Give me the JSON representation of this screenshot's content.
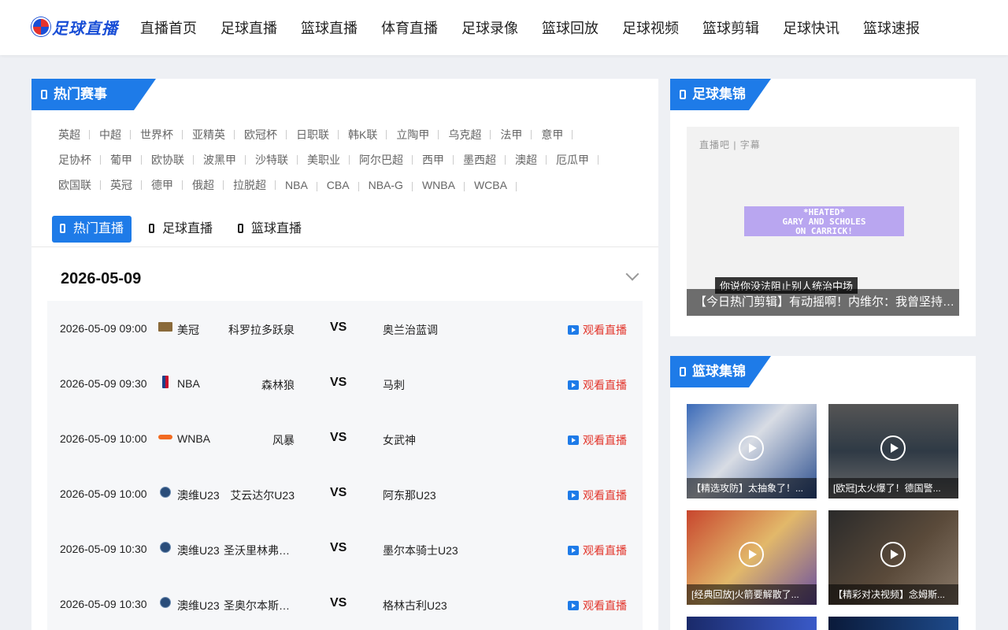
{
  "header": {
    "logo_text": "足球直播",
    "nav": [
      "直播首页",
      "足球直播",
      "篮球直播",
      "体育直播",
      "足球录像",
      "篮球回放",
      "足球视频",
      "篮球剪辑",
      "足球快讯",
      "篮球速报"
    ]
  },
  "hot_events": {
    "title": "热门赛事",
    "rows": [
      [
        "英超",
        "中超",
        "世界杯",
        "亚精英",
        "欧冠杯",
        "日职联",
        "韩K联",
        "立陶甲",
        "乌克超",
        "法甲",
        "意甲"
      ],
      [
        "足协杯",
        "葡甲",
        "欧协联",
        "波黑甲",
        "沙特联",
        "美职业",
        "阿尔巴超",
        "西甲",
        "墨西超",
        "澳超",
        "厄瓜甲"
      ],
      [
        "欧国联",
        "英冠",
        "德甲",
        "俄超",
        "拉脱超",
        "NBA",
        "CBA",
        "NBA-G",
        "WNBA",
        "WCBA"
      ]
    ]
  },
  "tabs": [
    "热门直播",
    "足球直播",
    "篮球直播"
  ],
  "date": "2026-05-09",
  "vs_label": "VS",
  "watch_label": "观看直播",
  "matches": [
    {
      "time": "2026-05-09 09:00",
      "league": "美冠",
      "home": "科罗拉多跃泉",
      "away": "奥兰治蓝调",
      "icon": "league-flag-icon"
    },
    {
      "time": "2026-05-09 09:30",
      "league": "NBA",
      "home": "森林狼",
      "away": "马刺",
      "icon": "nba-logo-icon"
    },
    {
      "time": "2026-05-09 10:00",
      "league": "WNBA",
      "home": "风暴",
      "away": "女武神",
      "icon": "wnba-logo-icon"
    },
    {
      "time": "2026-05-09 10:00",
      "league": "澳维U23",
      "home": "艾云达尔U23",
      "away": "阿东那U23",
      "icon": "globe-icon"
    },
    {
      "time": "2026-05-09 10:30",
      "league": "澳维U23",
      "home": "圣沃里林弗洛U...",
      "away": "墨尔本骑士U23",
      "icon": "globe-icon"
    },
    {
      "time": "2026-05-09 10:30",
      "league": "澳维U23",
      "home": "圣奥尔本斯圣...",
      "away": "格林古利U23",
      "icon": "globe-icon"
    }
  ],
  "football_highlights": {
    "title": "足球集锦",
    "watermark": "直播吧 | 字幕",
    "slate": [
      "*HEATED*",
      "GARY AND SCHOLES",
      "ON CARRICK!"
    ],
    "subtitle": "你说你没法阻止别人统治中场",
    "caption": "【今日热门剪辑】有动摇啊！内维尔：我曾坚持认为卡里克..."
  },
  "basketball_highlights": {
    "title": "篮球集锦",
    "items": [
      {
        "caption": "【精选攻防】太抽象了！..."
      },
      {
        "caption": "[欧冠]太火爆了！德国警..."
      },
      {
        "caption": "[经典回放]火箭要解散了..."
      },
      {
        "caption": "【精彩对决视频】念姆斯..."
      }
    ]
  },
  "colors": {
    "accent": "#1e7be8",
    "live_red": "#e2342a"
  }
}
